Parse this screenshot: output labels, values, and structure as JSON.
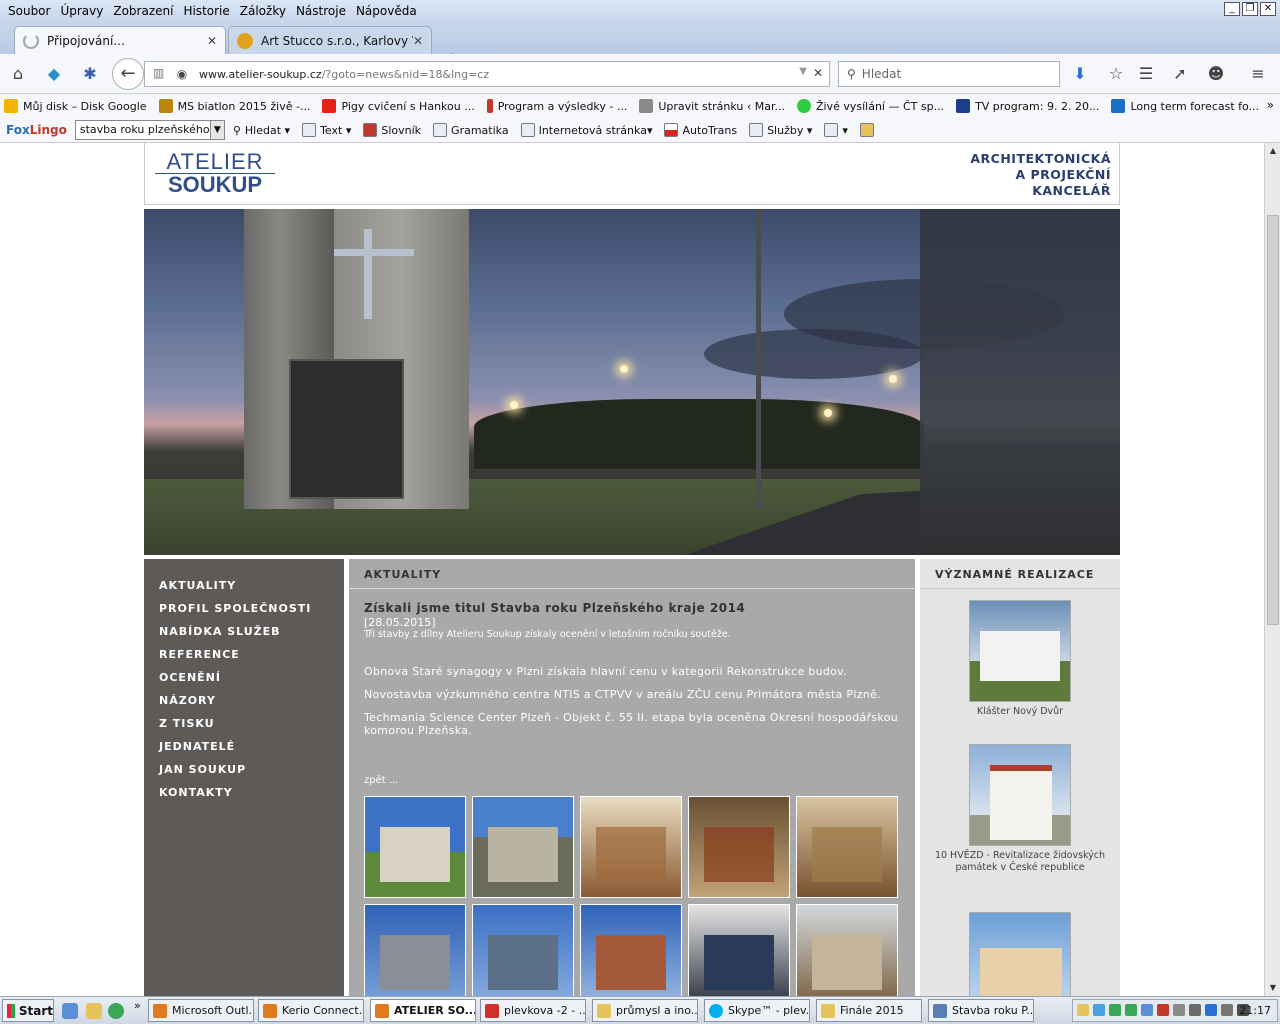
{
  "menubar": {
    "items": [
      "Soubor",
      "Úpravy",
      "Zobrazení",
      "Historie",
      "Záložky",
      "Nástroje",
      "Nápověda"
    ]
  },
  "tabs": [
    {
      "title": "Připojování...",
      "icon_color": "#9aa6b6"
    },
    {
      "title": "Art Stucco s.r.o., Karlovy Var...",
      "icon_color": "#e0a21e"
    }
  ],
  "navbar": {
    "url_domain": "www.atelier-soukup.cz",
    "url_path": "/?goto=news&nid=18&lng=cz",
    "search_placeholder": "Hledat"
  },
  "bookmarks": [
    {
      "label": "Můj disk – Disk Google",
      "icon_color": "#f4b400"
    },
    {
      "label": "MS biatlon 2015 živě -...",
      "icon_color": "#b8860b"
    },
    {
      "label": "Pigy cvičení s Hankou ...",
      "icon_color": "#e62117"
    },
    {
      "label": "Program a výsledky - ...",
      "icon_color": "#c0392b"
    },
    {
      "label": "Upravit stránku ‹ Mar...",
      "icon_color": "#8a8a8a"
    },
    {
      "label": "Živé vysílání — ČT sp...",
      "icon_color": "#2ecc40"
    },
    {
      "label": "TV program: 9. 2. 20...",
      "icon_color": "#1c3d8a"
    },
    {
      "label": "Long term forecast fo...",
      "icon_color": "#1a6fc4"
    }
  ],
  "foxbar": {
    "logo_a": "Fox",
    "logo_b": "Lingo",
    "input_value": "stavba roku plzeňského kr",
    "items": [
      "Hledat",
      "Text",
      "Slovník",
      "Gramatika",
      "Internetová stránka",
      "AutoTrans",
      "Služby"
    ]
  },
  "site": {
    "logo_line1": "ATELIER",
    "logo_line2": "SOUKUP",
    "tagline": [
      "ARCHITEKTONICKÁ",
      "A PROJEKČNÍ",
      "KANCELÁŘ"
    ],
    "nav": [
      "AKTUALITY",
      "PROFIL SPOLEČNOSTI",
      "NABÍDKA SLUŽEB",
      "REFERENCE",
      "OCENĚNÍ",
      "NÁZORY",
      "Z TISKU",
      "JEDNATELÉ",
      "JAN SOUKUP",
      "KONTAKTY"
    ],
    "main_heading": "AKTUALITY",
    "article": {
      "title": "Získali jsme titul Stavba roku Plzeňského kraje 2014",
      "date": "[28.05.2015]",
      "lead": "Tři stavby z dílny Atelieru Soukup získaly ocenění v letošním ročníku soutěže.",
      "paragraphs": [
        "Obnova Staré synagogy v Plzni získala hlavní cenu v kategorii Rekonstrukce budov.",
        "Novostavba výzkumného centra NTIS a CTPVV v areálu ZČU cenu Primátora města Plzně.",
        "Techmania Science Center Plzeň - Objekt č. 55 II. etapa byla oceněna Okresní hospodářskou komorou Plzeňska."
      ],
      "back_link": "zpět ..."
    },
    "right_heading": "VÝZNAMNÉ REALIZACE",
    "realizations": [
      "Klášter Nový Dvůr",
      "10 HVĚZD - Revitalizace židovských památek v České republice"
    ]
  },
  "taskbar": {
    "start": "Start",
    "buttons": [
      {
        "label": "Microsoft Outl...",
        "icon_color": "#1f5fb4"
      },
      {
        "label": "Kerio Connect...",
        "icon_color": "#e07a1e"
      },
      {
        "label": "ATELIER SO...",
        "icon_color": "#e07a1e"
      },
      {
        "label": "plevkova -2 - ...",
        "icon_color": "#d0312d"
      },
      {
        "label": "průmysl a ino...",
        "icon_color": "#e6c35c"
      },
      {
        "label": "Skype™ - plev...",
        "icon_color": "#00aff0"
      },
      {
        "label": "Finále 2015",
        "icon_color": "#e6c35c"
      },
      {
        "label": "Stavba roku P...",
        "icon_color": "#5a7fb5"
      }
    ],
    "clock": "21:17"
  },
  "colors": {
    "nav_bg": "#5e5a58",
    "main_bg": "#a9a9a9",
    "side_bg": "#e4e4e4",
    "brand_blue": "#2f4f8a"
  }
}
